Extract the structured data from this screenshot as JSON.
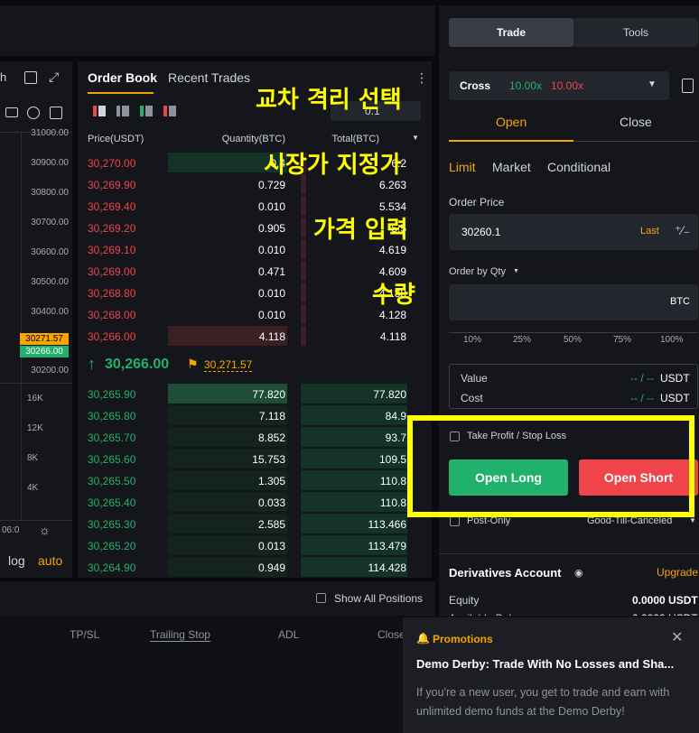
{
  "chart": {
    "timeframe": "h",
    "price_axis": [
      "31000.00",
      "30900.00",
      "30800.00",
      "30700.00",
      "30600.00",
      "30500.00",
      "30400.00",
      "30300.00",
      "30200.00"
    ],
    "price_tag_orange": "30271.57",
    "price_tag_green": "30266.00",
    "volume_axis": [
      "16K",
      "12K",
      "8K",
      "4K"
    ],
    "time_label": "06:0",
    "log_label": "log",
    "auto_label": "auto"
  },
  "orderbook": {
    "tab_orderbook": "Order Book",
    "tab_trades": "Recent Trades",
    "precision": "0.1",
    "col_price": "Price(USDT)",
    "col_qty": "Quantity(BTC)",
    "col_total": "Total(BTC)",
    "asks": [
      {
        "price": "30,270.00",
        "qty": "0.4",
        "total": "6.2"
      },
      {
        "price": "30,269.90",
        "qty": "0.729",
        "total": "6.263"
      },
      {
        "price": "30,269.40",
        "qty": "0.010",
        "total": "5.534"
      },
      {
        "price": "30,269.20",
        "qty": "0.905",
        "total": "5.5"
      },
      {
        "price": "30,269.10",
        "qty": "0.010",
        "total": "4.619"
      },
      {
        "price": "30,269.00",
        "qty": "0.471",
        "total": "4.609"
      },
      {
        "price": "30,268.80",
        "qty": "0.010",
        "total": "4.138"
      },
      {
        "price": "30,268.00",
        "qty": "0.010",
        "total": "4.128"
      },
      {
        "price": "30,266.00",
        "qty": "4.118",
        "total": "4.118"
      }
    ],
    "last_price": "30,266.00",
    "mark_price": "30,271.57",
    "bids": [
      {
        "price": "30,265.90",
        "qty": "77.820",
        "total": "77.820"
      },
      {
        "price": "30,265.80",
        "qty": "7.118",
        "total": "84.9"
      },
      {
        "price": "30,265.70",
        "qty": "8.852",
        "total": "93.7"
      },
      {
        "price": "30,265.60",
        "qty": "15.753",
        "total": "109.5"
      },
      {
        "price": "30,265.50",
        "qty": "1.305",
        "total": "110.8"
      },
      {
        "price": "30,265.40",
        "qty": "0.033",
        "total": "110.8"
      },
      {
        "price": "30,265.30",
        "qty": "2.585",
        "total": "113.466"
      },
      {
        "price": "30,265.20",
        "qty": "0.013",
        "total": "113.479"
      },
      {
        "price": "30,264.90",
        "qty": "0.949",
        "total": "114.428"
      }
    ]
  },
  "overlay": {
    "cross_isolated": "교차 격리 선택",
    "market_limit": "시장가 지정가",
    "price_input": "가격 입력",
    "quantity": "수량"
  },
  "trade": {
    "tab_trade": "Trade",
    "tab_tools": "Tools",
    "margin_mode": "Cross",
    "leverage_long": "10.00x",
    "leverage_short": "10.00x",
    "open_tab": "Open",
    "close_tab": "Close",
    "order_type_limit": "Limit",
    "order_type_market": "Market",
    "order_type_conditional": "Conditional",
    "order_price_label": "Order Price",
    "order_price_value": "30260.1",
    "last_label": "Last",
    "qty_label": "Order by Qty",
    "qty_unit": "BTC",
    "percentages": [
      "10%",
      "25%",
      "50%",
      "75%",
      "100%"
    ],
    "value_label": "Value",
    "value_amount": "-- / --",
    "value_unit": "USDT",
    "cost_label": "Cost",
    "cost_amount": "-- / --",
    "cost_unit": "USDT",
    "tpsl_label": "Take Profit / Stop Loss",
    "open_long": "Open Long",
    "open_short": "Open Short",
    "post_only": "Post-Only",
    "tif": "Good-Till-Canceled",
    "account_title": "Derivatives Account",
    "upgrade": "Upgrade",
    "equity_label": "Equity",
    "equity_value": "0.0000 USDT",
    "available_label": "Available Bal",
    "available_value": "0.0000 USDT"
  },
  "positions": {
    "show_all": "Show All Positions",
    "columns": [
      "TP/SL",
      "Trailing Stop",
      "ADL",
      "Close"
    ]
  },
  "promo": {
    "label": "Promotions",
    "title": "Demo Derby: Trade With No Losses and Sha...",
    "body": "If you're a new user, you get to trade and earn with unlimited demo funds at the Demo Derby!"
  },
  "colors": {
    "accent": "#f7a600",
    "buy": "#20b26c",
    "sell": "#ef454a",
    "highlight": "#ffff00"
  }
}
